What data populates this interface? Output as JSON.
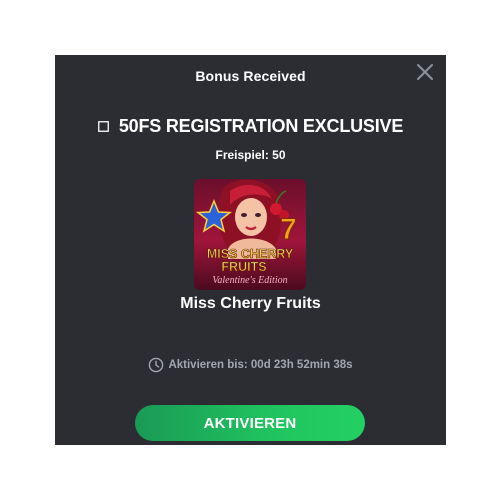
{
  "modal": {
    "title": "Bonus Received",
    "close_icon": "close-icon",
    "promo": {
      "icon": "gift-icon",
      "title": "50FS REGISTRATION EXCLUSIVE",
      "freespins_label": "Freispiel: 50"
    },
    "game": {
      "thumbnail_line1": "MISS CHERRY",
      "thumbnail_line2": "FRUITS",
      "thumbnail_subtitle": "Valentine's Edition",
      "name": "Miss Cherry Fruits"
    },
    "timer": {
      "icon": "clock-icon",
      "label": "Aktivieren bis: 00d 23h 52min 38s"
    },
    "activate_button": "AKTIVIEREN"
  },
  "colors": {
    "modal_bg": "#2b2d33",
    "accent_green": "#20c45f",
    "muted_text": "#a3a6ae"
  }
}
